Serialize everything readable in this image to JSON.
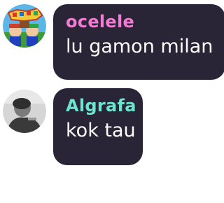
{
  "messages": [
    {
      "username": "ocelele",
      "text": "lu gamon milan",
      "username_color": "#f27bd3",
      "avatar_icon": "cartoon-game-avatar"
    },
    {
      "username": "Algrafa",
      "text": "kok tau",
      "username_color": "#6ee4cf",
      "avatar_icon": "grayscale-person-avatar"
    }
  ]
}
